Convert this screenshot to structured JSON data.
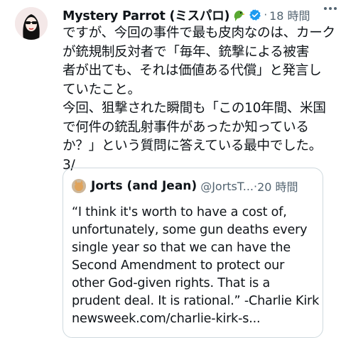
{
  "tweet": {
    "author_name": "Mystery Parrot (ミスパロ)",
    "separator": "·",
    "time": "18 時間",
    "body_lines": [
      "ですが、今回の事件で最も皮肉なのは、カーク",
      "が銃規制反対者で「毎年、銃撃による被害",
      "者が出ても、それは価値ある代償」と発言し",
      "ていたこと。",
      "今回、狙撃された瞬間も「この10年間、米国",
      "で何件の銃乱射事件があったか知っている",
      "か？」という質問に答えている最中でした。",
      "3/"
    ],
    "icons": {
      "emoji": "parrot-icon",
      "verified": "verified-badge-icon",
      "more": "more-options-icon",
      "avatar": "avatar-woman-sunglasses"
    },
    "colors": {
      "verified": "#1d9bf0",
      "secondary_text": "#536471",
      "border": "#cfd9de"
    }
  },
  "quoted": {
    "author_name": "Jorts (and Jean)",
    "handle": "@JortsT...",
    "separator": "·",
    "time": "20 時間",
    "body_lines": [
      "“I think it's worth to have a cost of,",
      "unfortunately, some gun deaths every",
      "single year so that we can have the",
      "Second Amendment to protect our",
      "other God-given rights. That is a",
      "prudent deal. It is rational.” -Charlie Kirk"
    ],
    "link": "newsweek.com/charlie-kirk-s..."
  }
}
